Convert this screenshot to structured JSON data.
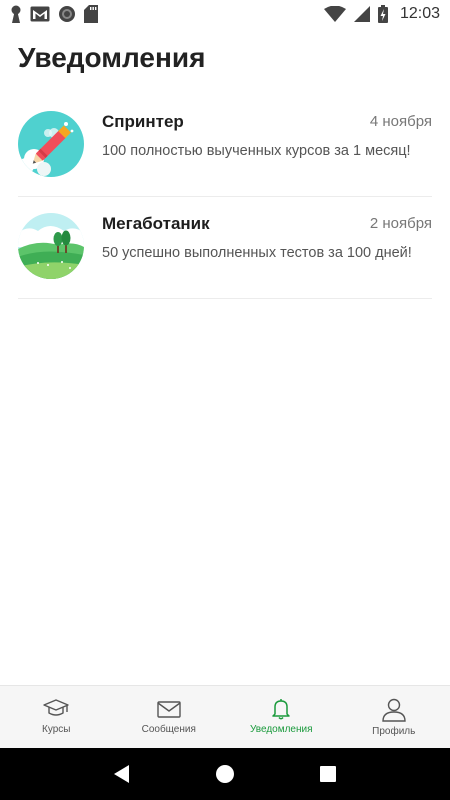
{
  "status_bar": {
    "time": "12:03",
    "icons": [
      "keyhole-icon",
      "gmail-icon",
      "circle-icon",
      "sd-card-icon",
      "wifi-icon",
      "signal-icon",
      "battery-icon"
    ]
  },
  "page": {
    "title": "Уведомления"
  },
  "notifications": [
    {
      "title": "Спринтер",
      "date": "4 ноября",
      "text": "100 полностью выученных курсов за 1 месяц!",
      "icon": "rocket-pencil-icon"
    },
    {
      "title": "Мегаботаник",
      "date": "2 ноября",
      "text": "50 успешно выполненных тестов за 100 дней!",
      "icon": "landscape-trees-icon"
    }
  ],
  "bottom_nav": {
    "items": [
      {
        "label": "Курсы",
        "icon": "graduation-cap-icon",
        "active": false
      },
      {
        "label": "Сообщения",
        "icon": "envelope-icon",
        "active": false
      },
      {
        "label": "Уведомления",
        "icon": "bell-icon",
        "active": true
      },
      {
        "label": "Профиль",
        "icon": "user-icon",
        "active": false
      }
    ]
  },
  "colors": {
    "accent": "#1a9a3c",
    "nav_background": "#f6f6f6",
    "system_bar": "#000000"
  }
}
